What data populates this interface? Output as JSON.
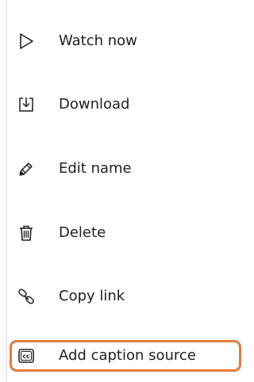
{
  "menu": {
    "items": [
      {
        "label": "Watch now",
        "icon": "play-icon"
      },
      {
        "label": "Download",
        "icon": "download-icon"
      },
      {
        "label": "Edit name",
        "icon": "pencil-icon"
      },
      {
        "label": "Delete",
        "icon": "trash-icon"
      },
      {
        "label": "Copy link",
        "icon": "link-icon"
      },
      {
        "label": "Add caption source",
        "icon": "cc-icon",
        "highlighted": true
      }
    ]
  },
  "colors": {
    "highlight_border": "#e8793b",
    "text": "#1f1f1f",
    "divider": "#d6d6d6"
  }
}
